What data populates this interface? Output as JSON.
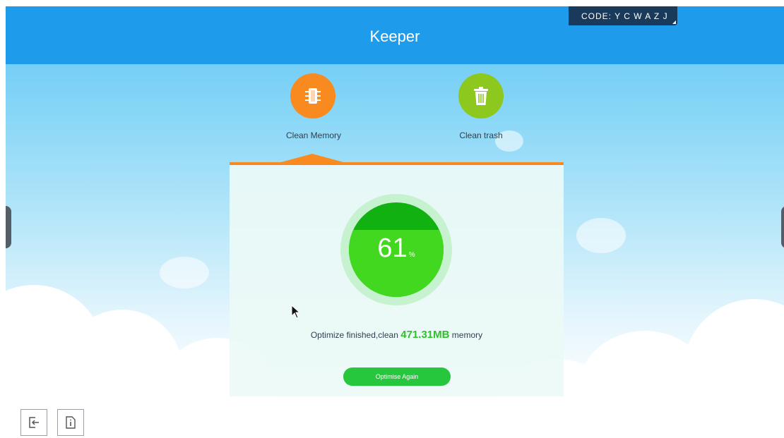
{
  "app": {
    "title": "Keeper",
    "code_label": "CODE: Y C W A Z J"
  },
  "tabs": [
    {
      "label": "Clean Memory",
      "icon": "memory-chip-icon",
      "color": "#f98a1f",
      "selected": true
    },
    {
      "label": "Clean trash",
      "icon": "trash-icon",
      "color": "#8cc81d",
      "selected": false
    }
  ],
  "gauge": {
    "value": "61",
    "unit": "%",
    "level_percent": 61,
    "colors": {
      "dark": "#11b112",
      "light": "#42d81f",
      "ring": "#c6f2cf"
    }
  },
  "result": {
    "prefix": "Optimize finished,clean ",
    "amount": "471.31MB",
    "suffix": " memory"
  },
  "actions": {
    "optimise_again_label": "Optimise Again"
  },
  "toolbar": {
    "items": [
      {
        "icon": "exit-icon"
      },
      {
        "icon": "info-document-icon"
      }
    ]
  },
  "colors": {
    "header": "#1e9bea",
    "accent_orange": "#f98a1f",
    "accent_green": "#26c63d",
    "badge": "#1a3a5c"
  }
}
